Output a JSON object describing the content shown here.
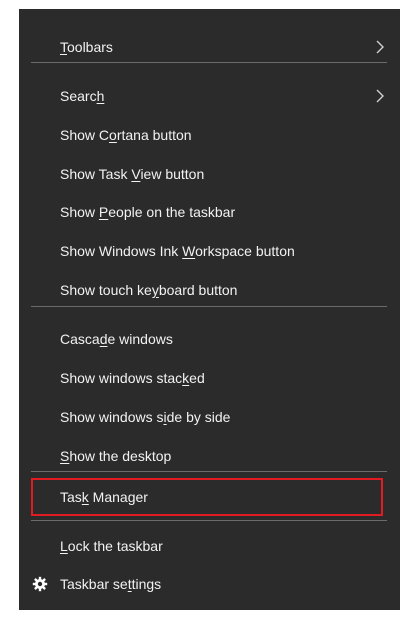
{
  "menu": {
    "items": [
      {
        "id": "toolbars",
        "pre": "",
        "key": "T",
        "post": "oolbars",
        "submenu": true
      },
      {
        "id": "search",
        "pre": "Searc",
        "key": "h",
        "post": "",
        "submenu": true
      },
      {
        "id": "show-cortana",
        "pre": "Show C",
        "key": "o",
        "post": "rtana button"
      },
      {
        "id": "show-task-view",
        "pre": "Show Task ",
        "key": "V",
        "post": "iew button"
      },
      {
        "id": "show-people",
        "pre": "Show ",
        "key": "P",
        "post": "eople on the taskbar"
      },
      {
        "id": "show-ink",
        "pre": "Show Windows Ink ",
        "key": "W",
        "post": "orkspace button"
      },
      {
        "id": "show-touch-keyboard",
        "pre": "Show touch ke",
        "key": "y",
        "post": "board button"
      },
      {
        "id": "cascade",
        "pre": "Casca",
        "key": "d",
        "post": "e windows"
      },
      {
        "id": "stacked",
        "pre": "Show windows stac",
        "key": "k",
        "post": "ed"
      },
      {
        "id": "side-by-side",
        "pre": "Show windows s",
        "key": "i",
        "post": "de by side"
      },
      {
        "id": "show-desktop",
        "pre": "",
        "key": "S",
        "post": "how the desktop"
      },
      {
        "id": "task-manager",
        "pre": "Tas",
        "key": "k",
        "post": " Manager"
      },
      {
        "id": "lock-taskbar",
        "pre": "",
        "key": "L",
        "post": "ock the taskbar"
      },
      {
        "id": "taskbar-settings",
        "pre": "Taskbar se",
        "key": "t",
        "post": "tings"
      }
    ]
  },
  "colors": {
    "menu_bg": "#2b2b2b",
    "text": "#f2f2f2",
    "separator": "#6a6a6a",
    "highlight_border": "#e11b22"
  },
  "icons": {
    "submenu_arrow": "chevron-right-icon",
    "settings": "gear-icon"
  }
}
